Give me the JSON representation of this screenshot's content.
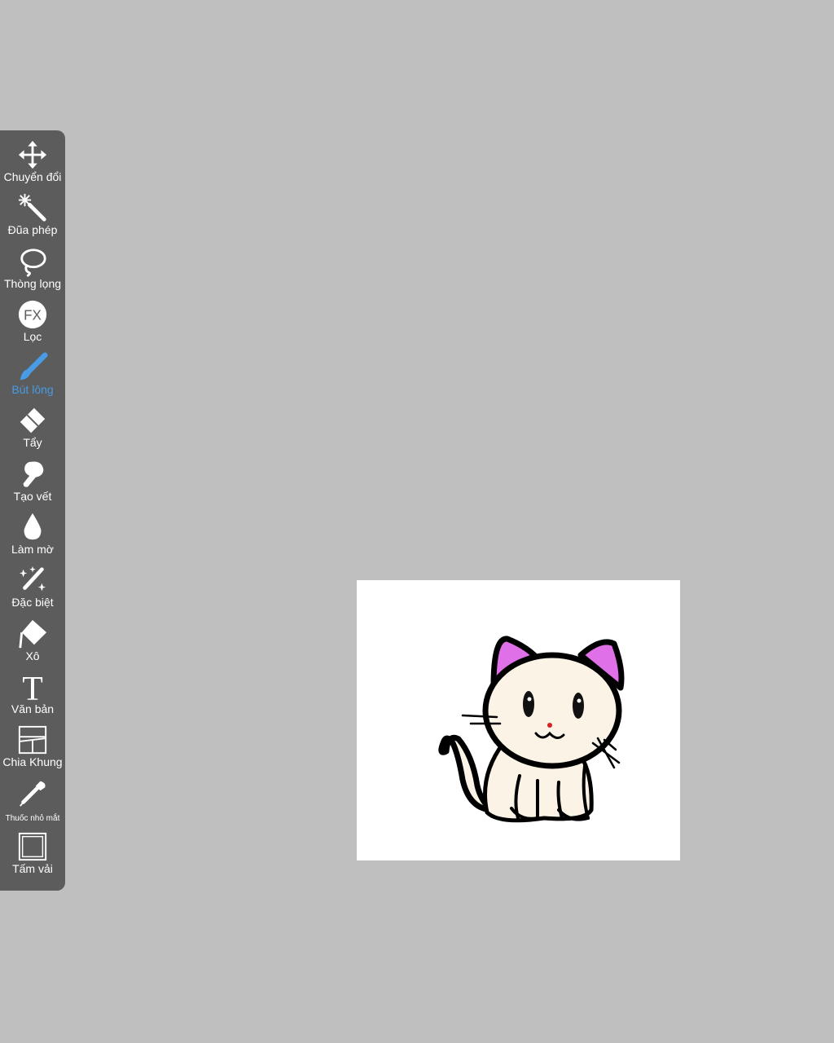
{
  "toolbar": {
    "active_color": "#4a9be5",
    "tools": [
      {
        "label": "Chuyển đổi",
        "icon": "move-arrows-icon"
      },
      {
        "label": "Đũa phép",
        "icon": "magic-wand-icon"
      },
      {
        "label": "Thòng lọng",
        "icon": "lasso-icon"
      },
      {
        "label": "Lọc",
        "icon": "fx-filter-icon"
      },
      {
        "label": "Bút lông",
        "icon": "brush-icon",
        "active": true
      },
      {
        "label": "Tẩy",
        "icon": "eraser-icon"
      },
      {
        "label": "Tạo vết",
        "icon": "smudge-icon"
      },
      {
        "label": "Làm mờ",
        "icon": "blur-drop-icon"
      },
      {
        "label": "Đặc biệt",
        "icon": "special-sparkle-pen-icon"
      },
      {
        "label": "Xô",
        "icon": "paint-bucket-icon"
      },
      {
        "label": "Văn bản",
        "icon": "text-t-icon"
      },
      {
        "label": "Chia Khung",
        "icon": "frame-divider-icon"
      },
      {
        "label": "Thuốc nhỏ mắt",
        "icon": "eyedropper-icon"
      },
      {
        "label": "Tấm vải",
        "icon": "canvas-square-icon"
      }
    ]
  },
  "canvas": {
    "background": "#ffffff",
    "drawing": "cat-sketch"
  }
}
